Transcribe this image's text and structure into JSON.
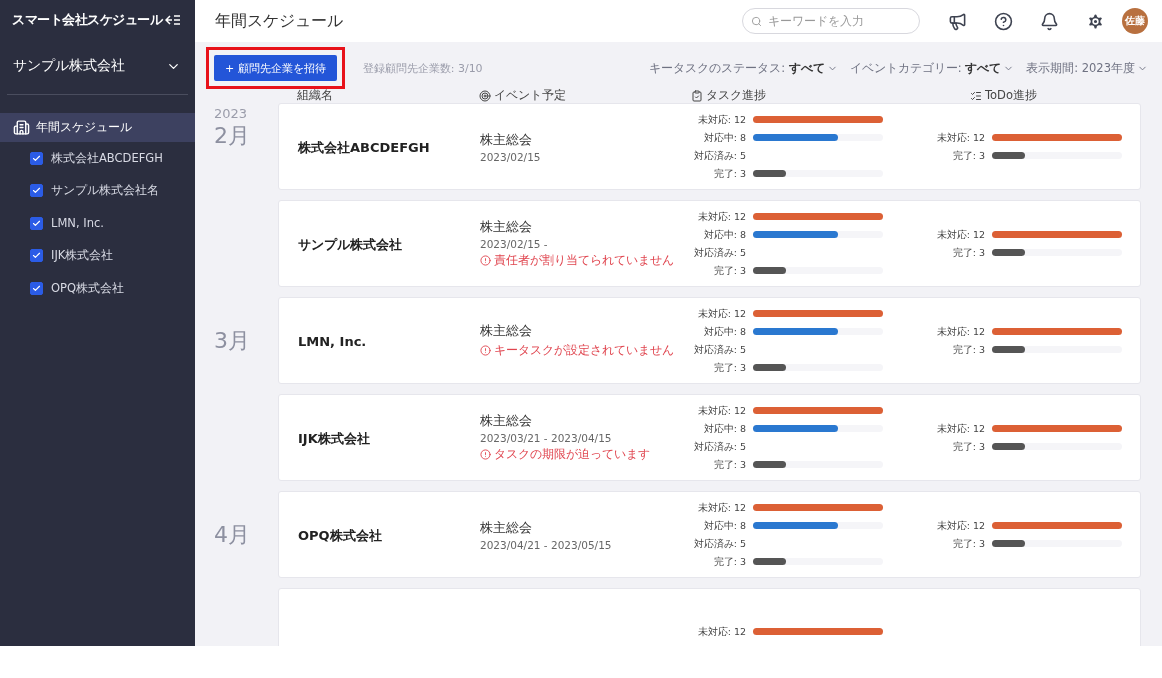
{
  "sidebar": {
    "app_title": "スマート会社スケジュール",
    "company": "サンプル株式会社",
    "nav": [
      {
        "label": "年間スケジュール",
        "selected": true
      }
    ],
    "companies": [
      {
        "label": "株式会社ABCDEFGH",
        "checked": true
      },
      {
        "label": "サンプル株式会社名",
        "checked": true
      },
      {
        "label": "LMN, Inc.",
        "checked": true
      },
      {
        "label": "IJK株式会社",
        "checked": true
      },
      {
        "label": "OPQ株式会社",
        "checked": true
      }
    ]
  },
  "header": {
    "title": "年間スケジュール",
    "search": {
      "placeholder": "キーワードを入力"
    },
    "avatar": "佐藤"
  },
  "toolbar": {
    "invite_button": "+ 顧問先企業を招待",
    "count": "登録顧問先企業数: 3/10",
    "filters": [
      "キータスクのステータス: **すべて**",
      "イベントカテゴリー: **すべて**",
      "表示期間: 2023年度"
    ]
  },
  "columns": [
    {
      "label": "組織名",
      "kind": "plain"
    },
    {
      "label": "イベント予定",
      "kind": "event"
    },
    {
      "label": "タスク進捗",
      "kind": "task"
    },
    {
      "label": "ToDo進捗",
      "kind": "todo"
    }
  ],
  "rows": [
    {
      "year": "2023",
      "month": "2月",
      "org": "株式会社ABCDEFGH",
      "event": {
        "title": "株主総会",
        "date": "2023/02/15"
      },
      "tasks": [
        {
          "label": "未対応: 12",
          "kind": "open",
          "level": 1
        },
        {
          "label": "対応中: 8",
          "kind": "progress",
          "level": 0.65
        },
        {
          "label": "対応済み: 5"
        },
        {
          "label": "完了: 3",
          "kind": "done",
          "level": 0.25
        }
      ],
      "todos": [
        {
          "label": "未対応: 12",
          "kind": "open",
          "level": 1
        },
        {
          "label": "完了: 3",
          "kind": "done",
          "level": 0.25
        }
      ]
    },
    {
      "org": "サンプル株式会社",
      "event": {
        "title": "株主総会",
        "date": "2023/02/15 -",
        "warning": "責任者が割り当てられていません"
      },
      "tasks": [
        {
          "label": "未対応: 12",
          "kind": "open",
          "level": 1
        },
        {
          "label": "対応中: 8",
          "kind": "progress",
          "level": 0.65
        },
        {
          "label": "対応済み: 5"
        },
        {
          "label": "完了: 3",
          "kind": "done",
          "level": 0.25
        }
      ],
      "todos": [
        {
          "label": "未対応: 12",
          "kind": "open",
          "level": 1
        },
        {
          "label": "完了: 3",
          "kind": "done",
          "level": 0.25
        }
      ]
    },
    {
      "month": "3月",
      "org": "LMN, Inc.",
      "event": {
        "title": "株主総会",
        "warning": "キータスクが設定されていません"
      },
      "tasks": [
        {
          "label": "未対応: 12",
          "kind": "open",
          "level": 1
        },
        {
          "label": "対応中: 8",
          "kind": "progress",
          "level": 0.65
        },
        {
          "label": "対応済み: 5"
        },
        {
          "label": "完了: 3",
          "kind": "done",
          "level": 0.25
        }
      ],
      "todos": [
        {
          "label": "未対応: 12",
          "kind": "open",
          "level": 1
        },
        {
          "label": "完了: 3",
          "kind": "done",
          "level": 0.25
        }
      ]
    },
    {
      "org": "IJK株式会社",
      "event": {
        "title": "株主総会",
        "date": "2023/03/21 - 2023/04/15",
        "warning": "タスクの期限が迫っています"
      },
      "tasks": [
        {
          "label": "未対応: 12",
          "kind": "open",
          "level": 1
        },
        {
          "label": "対応中: 8",
          "kind": "progress",
          "level": 0.65
        },
        {
          "label": "対応済み: 5"
        },
        {
          "label": "完了: 3",
          "kind": "done",
          "level": 0.25
        }
      ],
      "todos": [
        {
          "label": "未対応: 12",
          "kind": "open",
          "level": 1
        },
        {
          "label": "完了: 3",
          "kind": "done",
          "level": 0.25
        }
      ]
    },
    {
      "month": "4月",
      "org": "OPQ株式会社",
      "event": {
        "title": "株主総会",
        "date": "2023/04/21 - 2023/05/15"
      },
      "tasks": [
        {
          "label": "未対応: 12",
          "kind": "open",
          "level": 1
        },
        {
          "label": "対応中: 8",
          "kind": "progress",
          "level": 0.65
        },
        {
          "label": "対応済み: 5"
        },
        {
          "label": "完了: 3",
          "kind": "done",
          "level": 0.25
        }
      ],
      "todos": [
        {
          "label": "未対応: 12",
          "kind": "open",
          "level": 1
        },
        {
          "label": "完了: 3",
          "kind": "done",
          "level": 0.25
        }
      ]
    },
    {
      "tasks": [
        {
          "label": "未対応: 12",
          "kind": "open",
          "level": 1
        }
      ]
    }
  ]
}
